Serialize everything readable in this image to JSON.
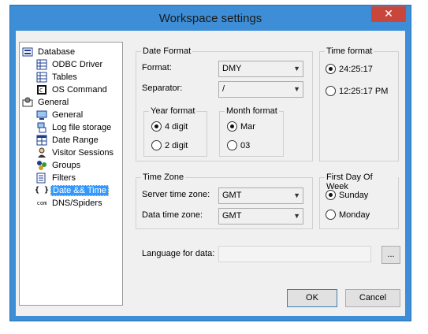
{
  "window": {
    "title": "Workspace settings",
    "close_glyph": "✕"
  },
  "tree": {
    "items": [
      {
        "label": "Database",
        "icon": "database-icon"
      },
      {
        "label": "ODBC Driver",
        "icon": "table-icon"
      },
      {
        "label": "Tables",
        "icon": "table-icon"
      },
      {
        "label": "OS Command",
        "icon": "command-icon"
      },
      {
        "label": "General",
        "icon": "settings-icon"
      },
      {
        "label": "General",
        "icon": "computer-icon"
      },
      {
        "label": "Log file storage",
        "icon": "storage-icon"
      },
      {
        "label": "Date Range",
        "icon": "calendar-icon"
      },
      {
        "label": "Visitor Sessions",
        "icon": "visitor-icon"
      },
      {
        "label": "Groups",
        "icon": "groups-icon"
      },
      {
        "label": "Filters",
        "icon": "filter-icon"
      },
      {
        "label": "Date && Time",
        "icon": "braces-icon"
      },
      {
        "label": "DNS/Spiders",
        "icon": "com-icon"
      }
    ]
  },
  "date_format": {
    "title": "Date Format",
    "format_label": "Format:",
    "format_value": "DMY",
    "separator_label": "Separator:",
    "separator_value": "/",
    "year_format": {
      "title": "Year format",
      "options": [
        "4 digit",
        "2 digit"
      ],
      "selected": "4 digit"
    },
    "month_format": {
      "title": "Month format",
      "options": [
        "Mar",
        "03"
      ],
      "selected": "Mar"
    }
  },
  "time_format": {
    "title": "Time format",
    "options": [
      "24:25:17",
      "12:25:17 PM"
    ],
    "selected": "24:25:17"
  },
  "time_zone": {
    "title": "Time Zone",
    "server_label": "Server time zone:",
    "server_value": "GMT",
    "data_label": "Data time zone:",
    "data_value": "GMT"
  },
  "first_day": {
    "title": "First Day Of Week",
    "options": [
      "Sunday",
      "Monday"
    ],
    "selected": "Sunday"
  },
  "language": {
    "label": "Language for data:",
    "value": "",
    "browse_label": "..."
  },
  "buttons": {
    "ok": "OK",
    "cancel": "Cancel"
  },
  "colors": {
    "titlebar": "#3d8ed7",
    "close": "#c9463d",
    "selection": "#3399ff"
  }
}
